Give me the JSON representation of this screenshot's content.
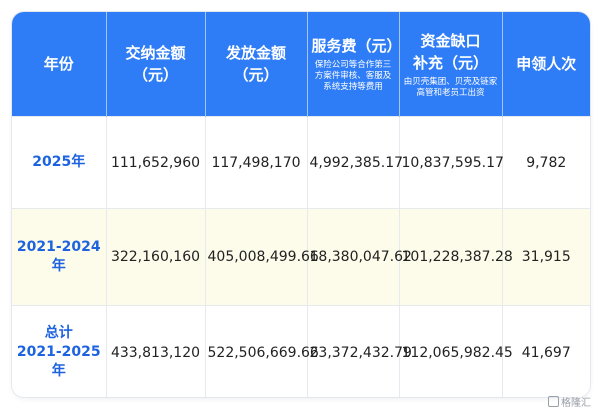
{
  "headers": [
    {
      "main": "年份",
      "sub": ""
    },
    {
      "main": "交纳金额\n（元）",
      "sub": ""
    },
    {
      "main": "发放金额\n（元）",
      "sub": ""
    },
    {
      "main": "服务费（元）",
      "sub": "保险公司等合作第三方案件审核、客服及系统支持等费用"
    },
    {
      "main": "资金缺口\n补充（元）",
      "sub": "由贝壳集团、贝壳及链家高管和老员工出资"
    },
    {
      "main": "申领人次",
      "sub": ""
    }
  ],
  "rows": [
    {
      "year": "2025年",
      "cells": [
        "111,652,960",
        "117,498,170",
        "4,992,385.17",
        "10,837,595.17",
        "9,782"
      ]
    },
    {
      "year": "2021-2024年",
      "cells": [
        "322,160,160",
        "405,008,499.66",
        "18,380,047.62",
        "101,228,387.28",
        "31,915"
      ]
    },
    {
      "year": "总计\n2021-2025年",
      "cells": [
        "433,813,120",
        "522,506,669.66",
        "23,372,432.79",
        "112,065,982.45",
        "41,697"
      ]
    }
  ],
  "watermark": "格隆汇",
  "colors": {
    "header_bg": "#2f7df6",
    "year_text": "#1d63e0",
    "row_highlight": "#fdfbea"
  }
}
